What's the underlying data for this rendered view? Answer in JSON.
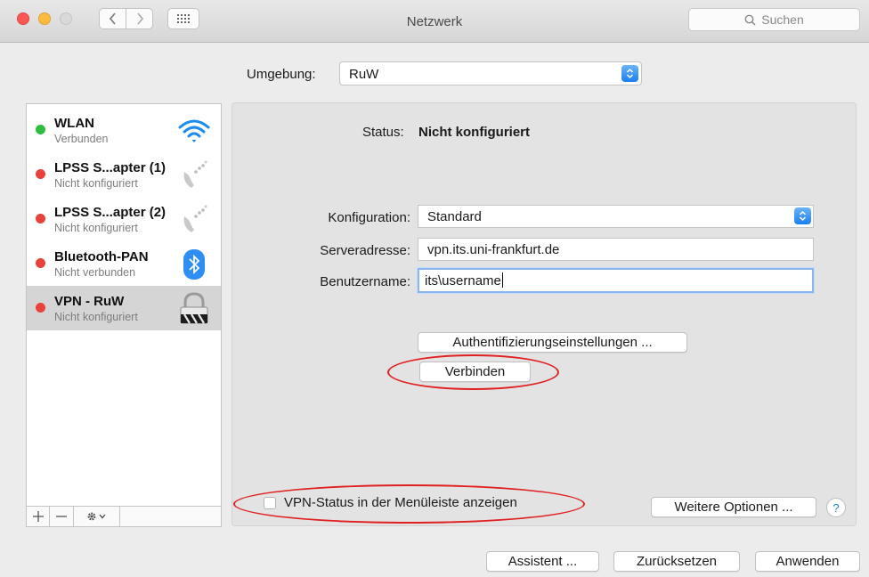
{
  "window": {
    "title": "Netzwerk"
  },
  "toolbar": {
    "search_placeholder": "Suchen"
  },
  "location": {
    "label": "Umgebung:",
    "value": "RuW"
  },
  "services": [
    {
      "name": "WLAN",
      "status": "Verbunden",
      "status_color": "#2ebd3e",
      "icon": "wifi-icon"
    },
    {
      "name": "LPSS S...apter (1)",
      "status": "Nicht konfiguriert",
      "status_color": "#e8423b",
      "icon": "phone-icon"
    },
    {
      "name": "LPSS S...apter (2)",
      "status": "Nicht konfiguriert",
      "status_color": "#e8423b",
      "icon": "phone-icon"
    },
    {
      "name": "Bluetooth-PAN",
      "status": "Nicht verbunden",
      "status_color": "#e8423b",
      "icon": "bluetooth-icon"
    },
    {
      "name": "VPN - RuW",
      "status": "Nicht konfiguriert",
      "status_color": "#e8423b",
      "icon": "vpn-lock-icon",
      "selected": true
    }
  ],
  "detail": {
    "status_label": "Status:",
    "status_value": "Nicht konfiguriert",
    "config_label": "Konfiguration:",
    "config_value": "Standard",
    "server_label": "Serveradresse:",
    "server_value": "vpn.its.uni-frankfurt.de",
    "user_label": "Benutzername:",
    "user_value": "its\\username",
    "auth_button": "Authentifizierungseinstellungen ...",
    "connect_button": "Verbinden",
    "show_status_label": "VPN-Status in der Menüleiste anzeigen",
    "more_options_button": "Weitere Optionen ...",
    "help_label": "?"
  },
  "footer": {
    "assistant": "Assistent ...",
    "revert": "Zurücksetzen",
    "apply": "Anwenden"
  },
  "colors": {
    "accent": "#1a7ff0",
    "annotation": "#e02020"
  }
}
